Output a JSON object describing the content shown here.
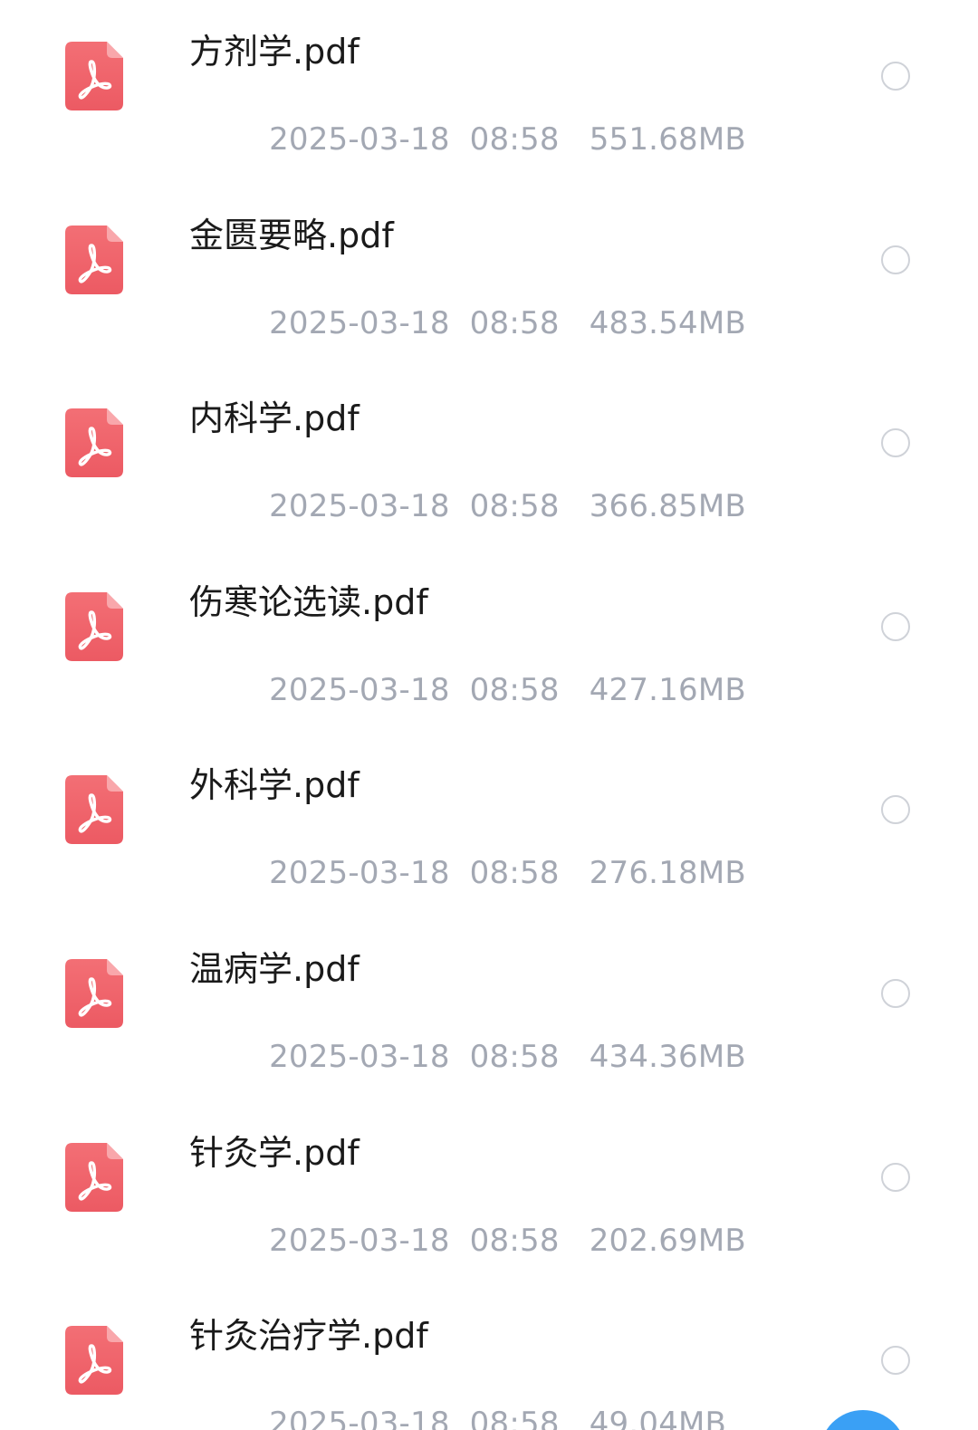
{
  "files": [
    {
      "name": "方剂学.pdf",
      "date": "2025-03-18",
      "time": "08:58",
      "size": "551.68MB",
      "icon": "pdf-file-icon",
      "selected": false
    },
    {
      "name": "金匮要略.pdf",
      "date": "2025-03-18",
      "time": "08:58",
      "size": "483.54MB",
      "icon": "pdf-file-icon",
      "selected": false
    },
    {
      "name": "内科学.pdf",
      "date": "2025-03-18",
      "time": "08:58",
      "size": "366.85MB",
      "icon": "pdf-file-icon",
      "selected": false
    },
    {
      "name": "伤寒论选读.pdf",
      "date": "2025-03-18",
      "time": "08:58",
      "size": "427.16MB",
      "icon": "pdf-file-icon",
      "selected": false
    },
    {
      "name": "外科学.pdf",
      "date": "2025-03-18",
      "time": "08:58",
      "size": "276.18MB",
      "icon": "pdf-file-icon",
      "selected": false
    },
    {
      "name": "温病学.pdf",
      "date": "2025-03-18",
      "time": "08:58",
      "size": "434.36MB",
      "icon": "pdf-file-icon",
      "selected": false
    },
    {
      "name": "针灸学.pdf",
      "date": "2025-03-18",
      "time": "08:58",
      "size": "202.69MB",
      "icon": "pdf-file-icon",
      "selected": false
    },
    {
      "name": "针灸治疗学.pdf",
      "date": "2025-03-18",
      "time": "08:58",
      "size": "49.04MB",
      "icon": "pdf-file-icon",
      "selected": false
    }
  ],
  "colors": {
    "pdf_icon": "#f0636a",
    "name_text": "#1a1a1a",
    "meta_text": "#a3a8b3",
    "radio_border": "#cfd2d8",
    "fab": "#3aa0f5"
  }
}
